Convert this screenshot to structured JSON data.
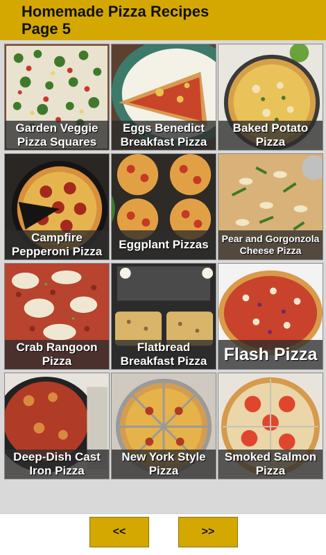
{
  "header": {
    "title_line1": "Homemade Pizza Recipes",
    "title_line2": "Page 5"
  },
  "recipes": [
    {
      "label": "Garden Veggie\nPizza Squares",
      "image": "veggie-pizza-squares"
    },
    {
      "label": "Eggs Benedict\nBreakfast Pizza",
      "image": "eggs-benedict-pizza-slice"
    },
    {
      "label": "Baked Potato\nPizza",
      "image": "baked-potato-pizza"
    },
    {
      "label": "Campfire\nPepperoni Pizza",
      "image": "campfire-pepperoni-pizza"
    },
    {
      "label": "Eggplant Pizzas",
      "image": "eggplant-pizzas"
    },
    {
      "label": "Pear and Gorgonzola\nCheese Pizza",
      "image": "pear-gorgonzola-pizza"
    },
    {
      "label": "Crab Rangoon\nPizza",
      "image": "crab-rangoon-pizza"
    },
    {
      "label": "Flatbread\nBreakfast Pizza",
      "image": "flatbread-breakfast-pizza"
    },
    {
      "label": "Flash Pizza",
      "image": "flash-pizza"
    },
    {
      "label": "Deep-Dish Cast\nIron Pizza",
      "image": "deep-dish-cast-iron-pizza"
    },
    {
      "label": "New York Style\nPizza",
      "image": "new-york-style-pizza"
    },
    {
      "label": "Smoked Salmon\nPizza",
      "image": "smoked-salmon-pizza"
    }
  ],
  "nav": {
    "prev_label": "<<",
    "next_label": ">>"
  }
}
